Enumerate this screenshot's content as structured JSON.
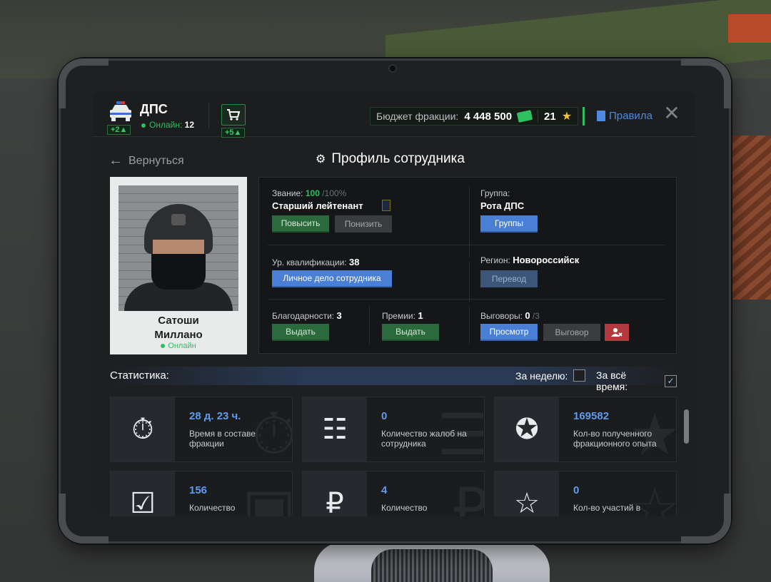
{
  "header": {
    "faction_name": "ДПС",
    "online_label": "Онлайн:",
    "online_count": "12",
    "car_badge": "+2",
    "cart_badge": "+5",
    "budget_label": "Бюджет фракции:",
    "budget_value": "4 448 500",
    "stars_value": "21",
    "rules_label": "Правила"
  },
  "nav": {
    "back_label": "Вернуться",
    "page_title": "Профиль сотрудника"
  },
  "profile": {
    "first_name": "Сатоши",
    "last_name": "Миллано",
    "status": "Онлайн"
  },
  "info": {
    "rank_label": "Звание:",
    "rank_progress": "100",
    "rank_max": "/100%",
    "rank_name": "Старший лейтенант",
    "promote_btn": "Повысить",
    "demote_btn": "Понизить",
    "group_label": "Группа:",
    "group_value": "Рота ДПС",
    "groups_btn": "Группы",
    "qual_label": "Ур. квалификации:",
    "qual_value": "38",
    "personal_file_btn": "Личное дело сотрудника",
    "region_label": "Регион:",
    "region_value": "Новороссийск",
    "transfer_btn": "Перевод",
    "thanks_label": "Благодарности:",
    "thanks_value": "3",
    "thanks_btn": "Выдать",
    "bonus_label": "Премии:",
    "bonus_value": "1",
    "bonus_btn": "Выдать",
    "reprimand_label": "Выговоры:",
    "reprimand_value": "0",
    "reprimand_max": "/3",
    "view_btn": "Просмотр",
    "reprimand_btn": "Выговор"
  },
  "stats": {
    "title": "Статистика:",
    "week_label": "За неделю:",
    "week_checked": false,
    "all_label": "За всё время:",
    "all_checked": true,
    "cards": [
      {
        "value": "28 д. 23 ч.",
        "desc": "Время в составе фракции",
        "icon": "stopwatch-icon"
      },
      {
        "value": "0",
        "desc": "Количество жалоб на сотрудника",
        "icon": "complaint-icon"
      },
      {
        "value": "169582",
        "desc": "Кол-во полученного фракционного опыта",
        "icon": "exp-icon"
      },
      {
        "value": "156",
        "desc": "Количество",
        "icon": "clipboard-icon"
      },
      {
        "value": "4",
        "desc": "Количество",
        "icon": "documents-icon"
      },
      {
        "value": "0",
        "desc": "Кол-во участий в",
        "icon": "star-icon"
      }
    ]
  },
  "colors": {
    "accent_blue": "#4a7fd6",
    "accent_green": "#2fbf5f",
    "danger": "#b03a3e"
  }
}
